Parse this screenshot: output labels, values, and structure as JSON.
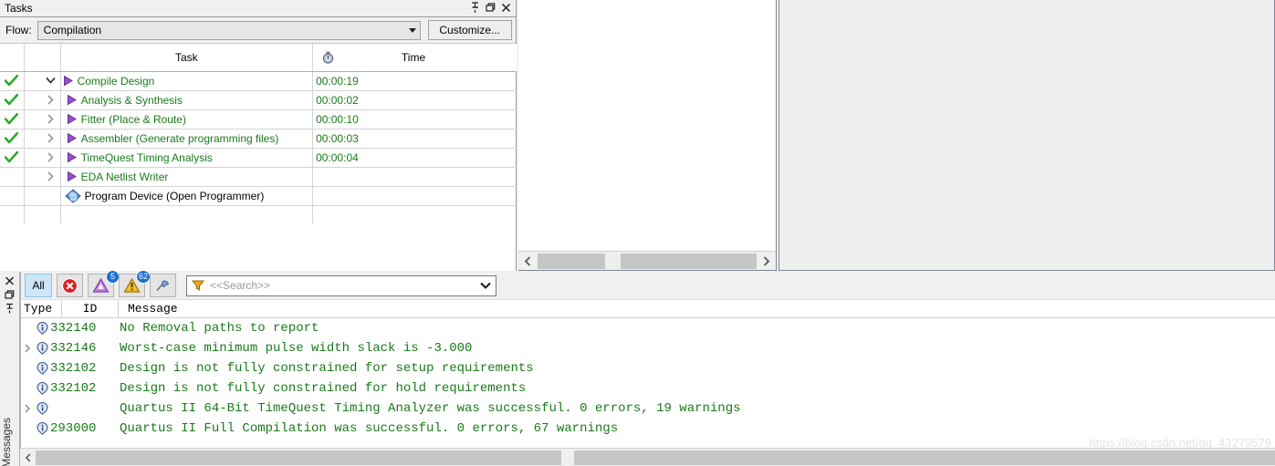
{
  "tasks_panel": {
    "title": "Tasks",
    "titlebar_icons": [
      "pin-icon",
      "restore-icon",
      "close-icon"
    ],
    "flow": {
      "label": "Flow:",
      "selected": "Compilation",
      "options": [
        "Compilation"
      ],
      "customize_label": "Customize..."
    },
    "columns": {
      "status": "",
      "task": "Task",
      "time": "Time",
      "time_icon": "stopwatch-icon"
    },
    "rows": [
      {
        "status": "done",
        "indent": 0,
        "expander": "down",
        "icon": "play-arrow-icon",
        "name": "Compile Design",
        "time": "00:00:19"
      },
      {
        "status": "done",
        "indent": 1,
        "expander": "right",
        "icon": "play-arrow-icon",
        "name": "Analysis & Synthesis",
        "time": "00:00:02"
      },
      {
        "status": "done",
        "indent": 1,
        "expander": "right",
        "icon": "play-arrow-icon",
        "name": "Fitter (Place & Route)",
        "time": "00:00:10"
      },
      {
        "status": "done",
        "indent": 1,
        "expander": "right",
        "icon": "play-arrow-icon",
        "name": "Assembler (Generate programming files)",
        "time": "00:00:03"
      },
      {
        "status": "done",
        "indent": 1,
        "expander": "right",
        "icon": "play-arrow-icon",
        "name": "TimeQuest Timing Analysis",
        "time": "00:00:04"
      },
      {
        "status": "none",
        "indent": 1,
        "expander": "right",
        "icon": "play-arrow-icon",
        "name": "EDA Netlist Writer",
        "time": ""
      },
      {
        "status": "none",
        "indent": 0,
        "expander": "none",
        "icon": "program-device-icon",
        "name": "Program Device (Open Programmer)",
        "time": ""
      }
    ]
  },
  "middle_panel": {
    "scrollbar": {
      "left_arrow": "chevron-left-icon",
      "right_arrow": "chevron-right-icon"
    }
  },
  "messages_dock": {
    "side_label": "Messages",
    "side_icons": [
      "close-icon",
      "restore-icon",
      "pin-icon"
    ],
    "toolbar": {
      "all_label": "All",
      "buttons": [
        {
          "name": "error-filter",
          "icon": "error-circle-icon",
          "badge": ""
        },
        {
          "name": "critical-warning-filter",
          "icon": "critical-warning-icon",
          "badge": "5"
        },
        {
          "name": "warning-filter",
          "icon": "warning-triangle-icon",
          "badge": "62"
        },
        {
          "name": "info-filter",
          "icon": "flag-pen-icon",
          "badge": ""
        }
      ],
      "search": {
        "placeholder": "<<Search>>",
        "value": "",
        "icon": "funnel-icon",
        "chevron": "chevron-down-icon"
      }
    },
    "columns": {
      "type": "Type",
      "id": "ID",
      "message": "Message"
    },
    "rows": [
      {
        "expandable": false,
        "icon": "info-icon",
        "id": "332140",
        "message": "No Removal paths to report"
      },
      {
        "expandable": true,
        "icon": "info-icon",
        "id": "332146",
        "message": "Worst-case minimum pulse width slack is -3.000"
      },
      {
        "expandable": false,
        "icon": "info-icon",
        "id": "332102",
        "message": "Design is not fully constrained for setup requirements"
      },
      {
        "expandable": false,
        "icon": "info-icon",
        "id": "332102",
        "message": "Design is not fully constrained for hold requirements"
      },
      {
        "expandable": true,
        "icon": "info-icon",
        "id": "",
        "message": "Quartus II 64-Bit TimeQuest Timing Analyzer was successful. 0 errors, 19 warnings"
      },
      {
        "expandable": false,
        "icon": "info-icon",
        "id": "293000",
        "message": "Quartus II Full Compilation was successful. 0 errors, 67 warnings"
      }
    ]
  },
  "watermark": "https://blog.csdn.net/qq_43279579",
  "colors": {
    "task_text_green": "#1a7a1a",
    "message_text_green": "#1a7a1a",
    "badge_blue": "#1c6fd0",
    "tab_active_blue": "#cde6f7",
    "panel_gray": "#f0f0f0"
  }
}
